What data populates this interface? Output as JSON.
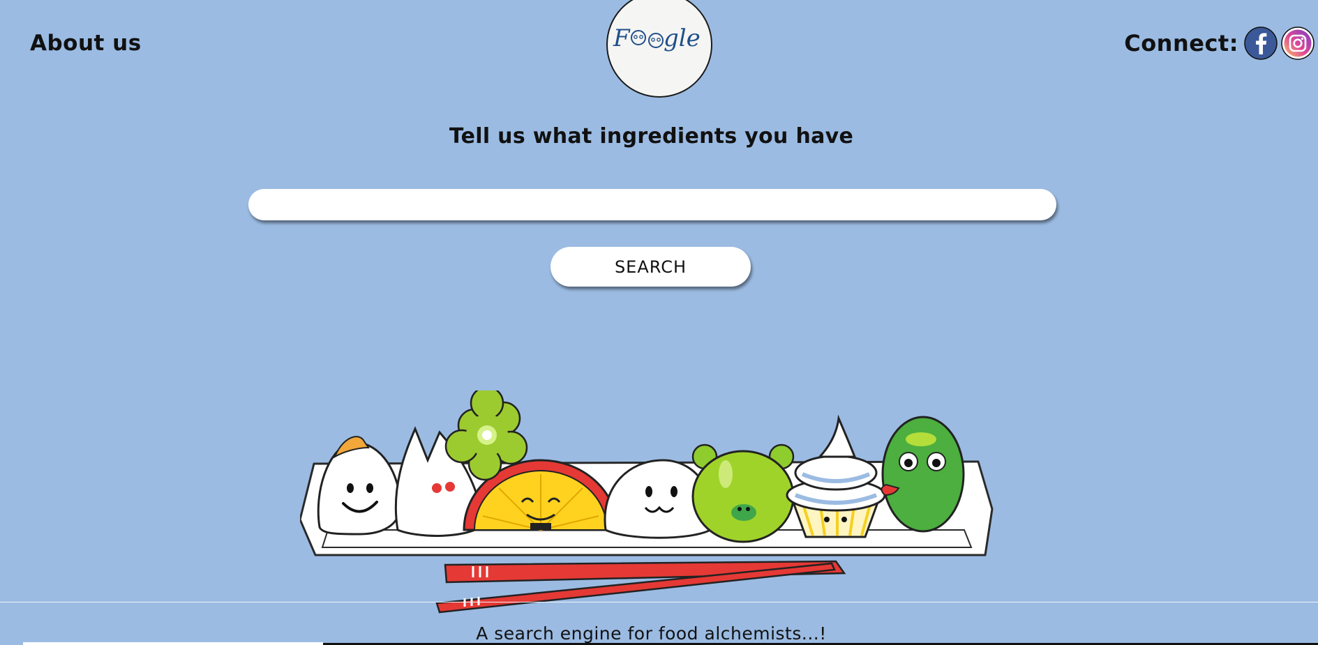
{
  "header": {
    "about_label": "About us",
    "logo_text": "Foogle",
    "connect_label": "Connect:",
    "social": [
      {
        "name": "facebook",
        "icon": "facebook-icon",
        "color": "#3b5998"
      },
      {
        "name": "instagram",
        "icon": "instagram-icon",
        "color": "#d6249f"
      }
    ]
  },
  "main": {
    "heading": "Tell us what ingredients you have",
    "search_value": "",
    "search_placeholder": "",
    "search_button_label": "SEARCH"
  },
  "illustration": {
    "name": "kawaii-food-tray-illustration"
  },
  "footer": {
    "tagline": "A search engine for food alchemists...!"
  },
  "colors": {
    "background": "#9bbbe2",
    "input_background": "#ffffff",
    "text": "#111111",
    "logo_ink": "#1f4f8a"
  }
}
